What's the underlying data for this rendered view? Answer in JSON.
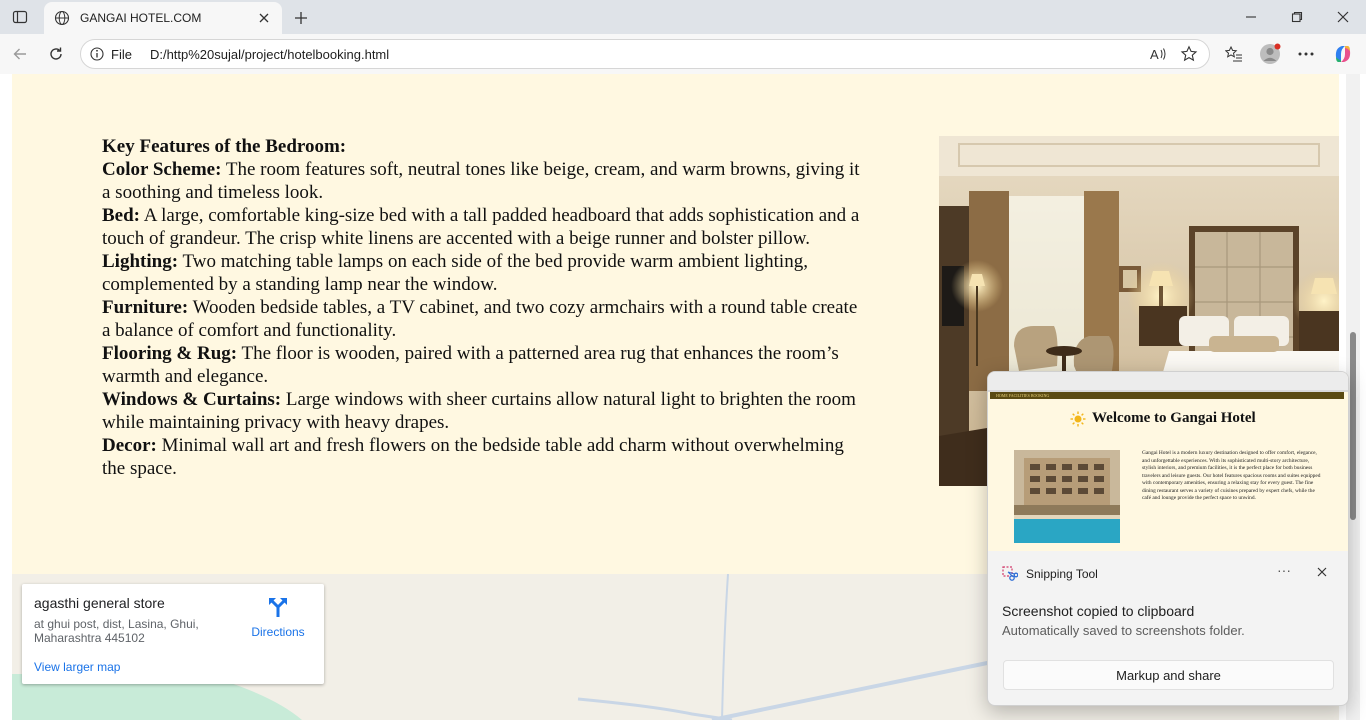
{
  "browser": {
    "tab_title": "GANGAI HOTEL.COM",
    "address_prefix": "File",
    "url": "D:/http%20sujal/project/hotelbooking.html"
  },
  "features": {
    "heading": "Key Features of the Bedroom:",
    "items": [
      {
        "label": "Color Scheme:",
        "text": " The room features soft, neutral tones like beige, cream, and warm browns, giving it a soothing and timeless look."
      },
      {
        "label": "Bed:",
        "text": " A large, comfortable king-size bed with a tall padded headboard that adds sophistication and a touch of grandeur. The crisp white linens are accented with a beige runner and bolster pillow."
      },
      {
        "label": "Lighting:",
        "text": " Two matching table lamps on each side of the bed provide warm ambient lighting, complemented by a standing lamp near the window."
      },
      {
        "label": "Furniture:",
        "text": " Wooden bedside tables, a TV cabinet, and two cozy armchairs with a round table create a balance of comfort and functionality."
      },
      {
        "label": "Flooring & Rug:",
        "text": " The floor is wooden, paired with a patterned area rug that enhances the room’s warmth and elegance."
      },
      {
        "label": "Windows & Curtains:",
        "text": " Large windows with sheer curtains allow natural light to brighten the room while maintaining privacy with heavy drapes."
      },
      {
        "label": "Decor:",
        "text": " Minimal wall art and fresh flowers on the bedside table add charm without overwhelming the space."
      }
    ]
  },
  "map": {
    "place_name": "agasthi general store",
    "address": "at ghui post, dist, Lasina, Ghui, Maharashtra 445102",
    "directions_label": "Directions",
    "larger_map_label": "View larger map"
  },
  "toast": {
    "app_name": "Snipping Tool",
    "more_label": "···",
    "message": "Screenshot copied to clipboard",
    "sub_message": "Automatically saved to screenshots folder.",
    "button_label": "Markup and share",
    "preview": {
      "strip_text": "HOME FACILITIES BOOKING",
      "title": "Welcome to Gangai Hotel",
      "paragraph": "Gangai Hotel is a modern luxury destination designed to offer comfort, elegance, and unforgettable experiences. With its sophisticated multi-story architecture, stylish interiors, and premium facilities, it is the perfect place for both business travelers and leisure guests. Our hotel features spacious rooms and suites equipped with contemporary amenities, ensuring a relaxing stay for every guest. The fine dining restaurant serves a variety of cuisines prepared by expert chefs, while the café and lounge provide the perfect space to unwind."
    }
  }
}
